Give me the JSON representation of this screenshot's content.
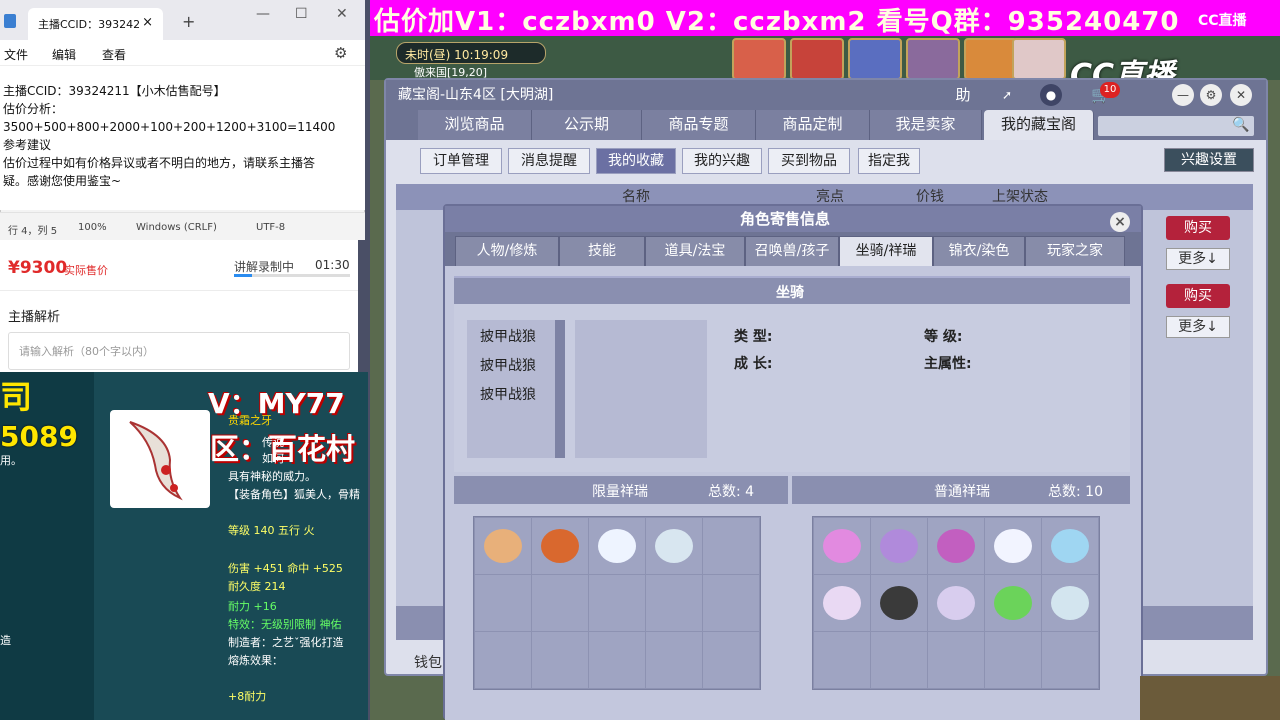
{
  "notepad": {
    "tab_title": "主播CCID：393242",
    "menu": [
      "文件",
      "编辑",
      "查看"
    ],
    "content": "主播CCID：39324211【小木估售配号】\n估价分析：\n3500+500+800+2000+100+200+1200+3100=11400\n参考建议\n估价过程中如有价格异议或者不明白的地方，请联系主播答\n疑。感谢您使用鉴宝~",
    "status": [
      "行 4，列 5",
      "100%",
      "Windows (CRLF)",
      "UTF-8"
    ]
  },
  "stream_panel": {
    "price": "¥9300",
    "price_label": "实际售价",
    "recording": "讲解录制中",
    "rec_time": "01:30",
    "analysis_title": "主播解析",
    "analysis_placeholder": "请输入解析（80个字以内）"
  },
  "left_game": {
    "big1": "司",
    "big2": "5089",
    "small1": "用。",
    "small2": "造",
    "overlay_v": "V：MY77",
    "overlay_q": "区：百花村",
    "item_name": "贵霜之牙",
    "desc1": "传说",
    "desc2": "如何",
    "desc3": "具有神秘的威力。",
    "equip": "【装备角色】狐美人，骨精",
    "level": "等级 140 五行 火",
    "damage": "伤害 +451 命中 +525",
    "durability": "耐久度 214",
    "stamina": "耐力 +16",
    "effect": "特效：无级别限制 神佑",
    "maker": "制造者：之艺ˇ强化打造",
    "refine": "熔炼效果：",
    "refine_val": "+8耐力"
  },
  "banner": {
    "text": "估价加V1：cczbxm0    V2：cczbxm2   看号Q群：935240470"
  },
  "game": {
    "clock": "未时(昼)  10:19:09",
    "area": "傲来国[19,20]",
    "logo": "CC直播",
    "logo_small": "CC直播"
  },
  "main": {
    "title": "藏宝阁-山东4区 [大明湖]",
    "badge": "10",
    "tabs": [
      "浏览商品",
      "公示期",
      "商品专题",
      "商品定制",
      "我是卖家",
      "我的藏宝阁"
    ],
    "subtabs": [
      "订单管理",
      "消息提醒",
      "我的收藏",
      "我的兴趣",
      "买到物品",
      "指定我"
    ],
    "interest_btn": "兴趣设置",
    "columns": [
      "名称",
      "亮点",
      "价钱",
      "上架状态"
    ],
    "buy": "购买",
    "more": "更多↓",
    "wallet": "钱包"
  },
  "dialog": {
    "title": "角色寄售信息",
    "tabs": [
      "人物/修炼",
      "技能",
      "道具/法宝",
      "召唤兽/孩子",
      "坐骑/祥瑞",
      "锦衣/染色",
      "玩家之家"
    ],
    "section": "坐骑",
    "mounts": [
      "披甲战狼",
      "披甲战狼",
      "披甲战狼"
    ],
    "attr_type": "类  型:",
    "attr_grow": "成  长:",
    "attr_level": "等  级:",
    "attr_main": "主属性:",
    "limited_title": "限量祥瑞",
    "limited_total": "总数: 4",
    "normal_title": "普通祥瑞",
    "normal_total": "总数: 10"
  },
  "colors": {
    "limited": [
      "#e8b07a",
      "#d9682e",
      "#eef4ff",
      "#d8e6f0"
    ],
    "normal": [
      "#e28ae0",
      "#b08adb",
      "#c25fc0",
      "#f2f4ff",
      "#9fd6f2",
      "#e9d9f3",
      "#3a3a3a",
      "#d8cdee",
      "#6bd35a",
      "#d3e5ef"
    ]
  }
}
